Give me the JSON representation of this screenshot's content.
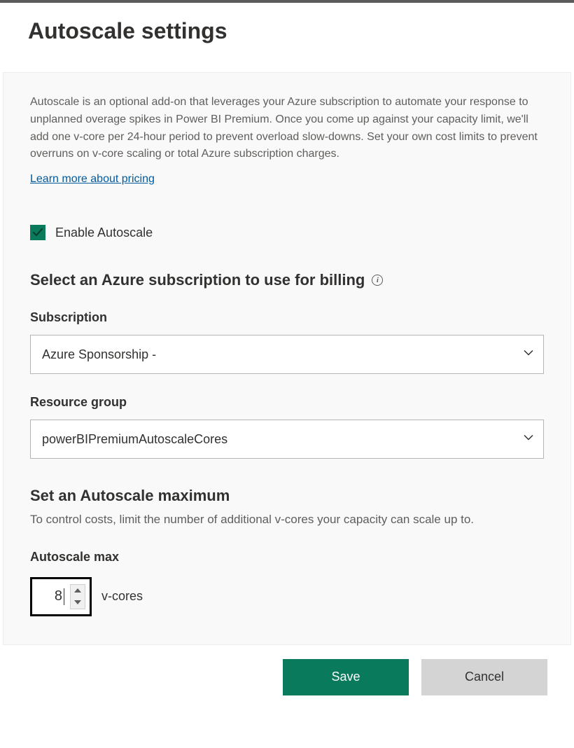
{
  "header": {
    "title": "Autoscale settings"
  },
  "description": "Autoscale is an optional add-on that leverages your Azure subscription to automate your response to unplanned overage spikes in Power BI Premium. Once you come up against your capacity limit, we'll add one v-core per 24-hour period to prevent overload slow-downs. Set your own cost limits to prevent overruns on v-core scaling or total Azure subscription charges.",
  "link_label": "Learn more about pricing",
  "enable": {
    "checked": true,
    "label": "Enable Autoscale"
  },
  "billing_section": {
    "title": "Select an Azure subscription to use for billing"
  },
  "subscription": {
    "label": "Subscription",
    "selected": "Azure Sponsorship -"
  },
  "resource_group": {
    "label": "Resource group",
    "selected": "powerBIPremiumAutoscaleCores"
  },
  "max_section": {
    "title": "Set an Autoscale maximum",
    "description": "To control costs, limit the number of additional v-cores your capacity can scale up to.",
    "field_label": "Autoscale max",
    "value": "8",
    "unit": "v-cores"
  },
  "buttons": {
    "save": "Save",
    "cancel": "Cancel"
  },
  "colors": {
    "accent": "#0a7a5c",
    "link": "#005a9e"
  }
}
